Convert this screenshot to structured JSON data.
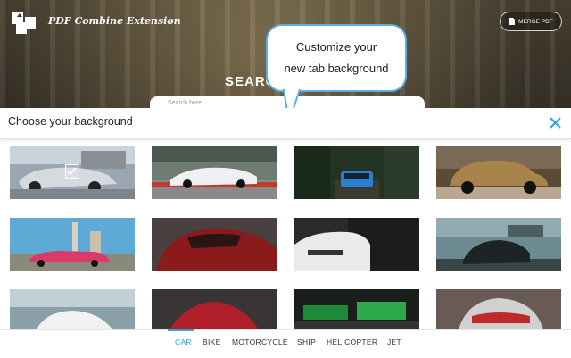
{
  "header": {
    "app_title": "PDF Combine Extension",
    "merge_button_label": "MERGE PDF",
    "logo_icon": "pdf-logo-icon"
  },
  "search": {
    "heading": "SEARC",
    "placeholder": "Search here"
  },
  "tooltip": {
    "line1": "Customize your",
    "line2": "new tab background"
  },
  "panel": {
    "title": "Choose your background",
    "close_icon": "close-icon",
    "selected_index": 0,
    "thumbnails": [
      {
        "scene": "silver convertible"
      },
      {
        "scene": "white sports car on track"
      },
      {
        "scene": "blue car in forest"
      },
      {
        "scene": "vintage beetle"
      },
      {
        "scene": "pink classic car city"
      },
      {
        "scene": "red sports car"
      },
      {
        "scene": "white car dark room"
      },
      {
        "scene": "car by water"
      },
      {
        "scene": "white car"
      },
      {
        "scene": "red car"
      },
      {
        "scene": "green race cars"
      },
      {
        "scene": "red and white car"
      }
    ]
  },
  "tabs": [
    {
      "label": "CAR",
      "active": true
    },
    {
      "label": "BIKE",
      "active": false
    },
    {
      "label": "MOTORCYCLE",
      "active": false
    },
    {
      "label": "SHIP",
      "active": false
    },
    {
      "label": "HELICOPTER",
      "active": false
    },
    {
      "label": "JET",
      "active": false
    }
  ],
  "colors": {
    "accent": "#2ea3dd",
    "bubble_border": "#5ab0e6"
  }
}
